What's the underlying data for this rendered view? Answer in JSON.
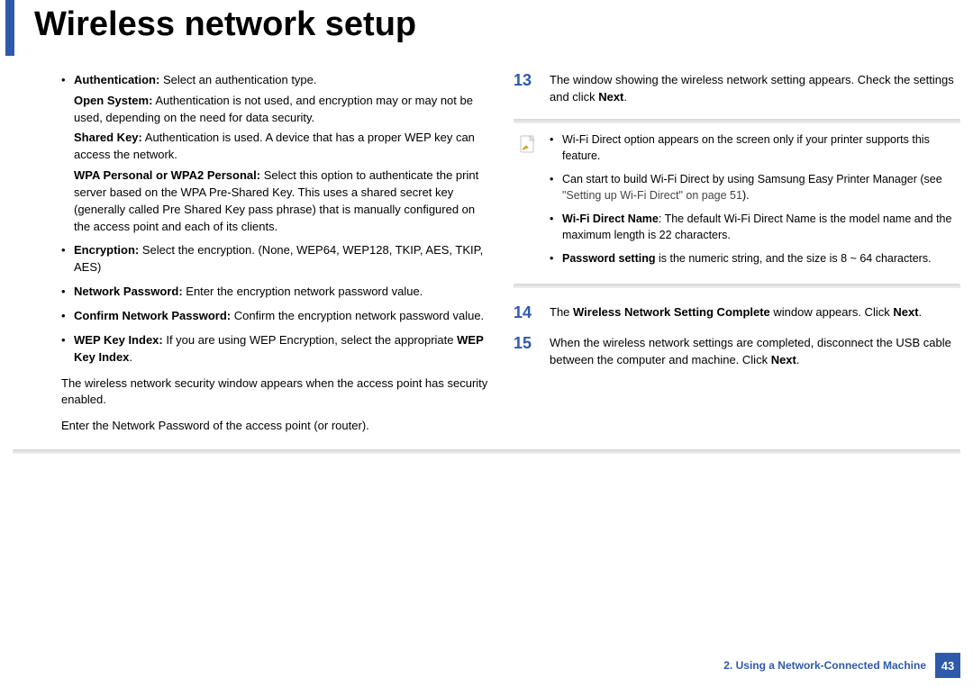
{
  "title": "Wireless network setup",
  "left": {
    "bullets": [
      {
        "lead": "Authentication:",
        "tail": " Select an authentication type.",
        "subs": [
          {
            "lead": "Open System:",
            "tail": " Authentication is not used, and encryption may or may not be used, depending on the need for data security."
          },
          {
            "lead": "Shared Key:",
            "tail": " Authentication is used. A device that has a proper WEP key can access the network."
          },
          {
            "lead": "WPA Personal or WPA2 Personal:",
            "tail": " Select this option to authenticate the print server based on the WPA Pre-Shared Key. This uses a shared secret key (generally called Pre Shared Key pass phrase) that is manually configured on the access point and each of its clients."
          }
        ]
      },
      {
        "lead": "Encryption:",
        "tail": " Select the encryption. (None, WEP64, WEP128, TKIP, AES, TKIP, AES)"
      },
      {
        "lead": "Network Password:",
        "tail": " Enter the encryption network password value."
      },
      {
        "lead": "Confirm Network Password:",
        "tail": " Confirm the encryption network password value."
      },
      {
        "lead": "WEP Key Index:",
        "tail": " If you are using WEP Encryption, select the appropriate ",
        "trail_bold": "WEP Key Index",
        "trail_after": "."
      }
    ],
    "p1": "The wireless network security window appears when the access point has security enabled.",
    "p2": "Enter the Network Password of the access point (or router)."
  },
  "right": {
    "step13": {
      "num": "13",
      "pre": "The window showing the wireless network setting appears. Check the settings and click ",
      "bold": "Next",
      "post": "."
    },
    "note": {
      "b1": "Wi-Fi Direct option appears on the screen only if your printer supports this feature.",
      "b2_pre": "Can start to build Wi-Fi Direct by using Samsung Easy Printer Manager (see ",
      "b2_ref": "\"Setting up Wi-Fi Direct\" on page 51",
      "b2_post": ").",
      "b3_lead": "Wi-Fi Direct Name",
      "b3_tail": ": The default Wi-Fi Direct Name is the model name and the maximum length is 22 characters.",
      "b4_lead": "Password setting",
      "b4_tail": " is the numeric string, and the size is 8 ~ 64 characters."
    },
    "step14": {
      "num": "14",
      "pre": "The ",
      "bold": "Wireless Network Setting Complete",
      "mid": " window appears. Click ",
      "bold2": "Next",
      "post": "."
    },
    "step15": {
      "num": "15",
      "pre": "When the wireless network settings are completed, disconnect the USB cable between the computer and machine. Click ",
      "bold": "Next",
      "post": "."
    }
  },
  "footer": {
    "chapter": "2.  Using a Network-Connected Machine",
    "page": "43"
  }
}
